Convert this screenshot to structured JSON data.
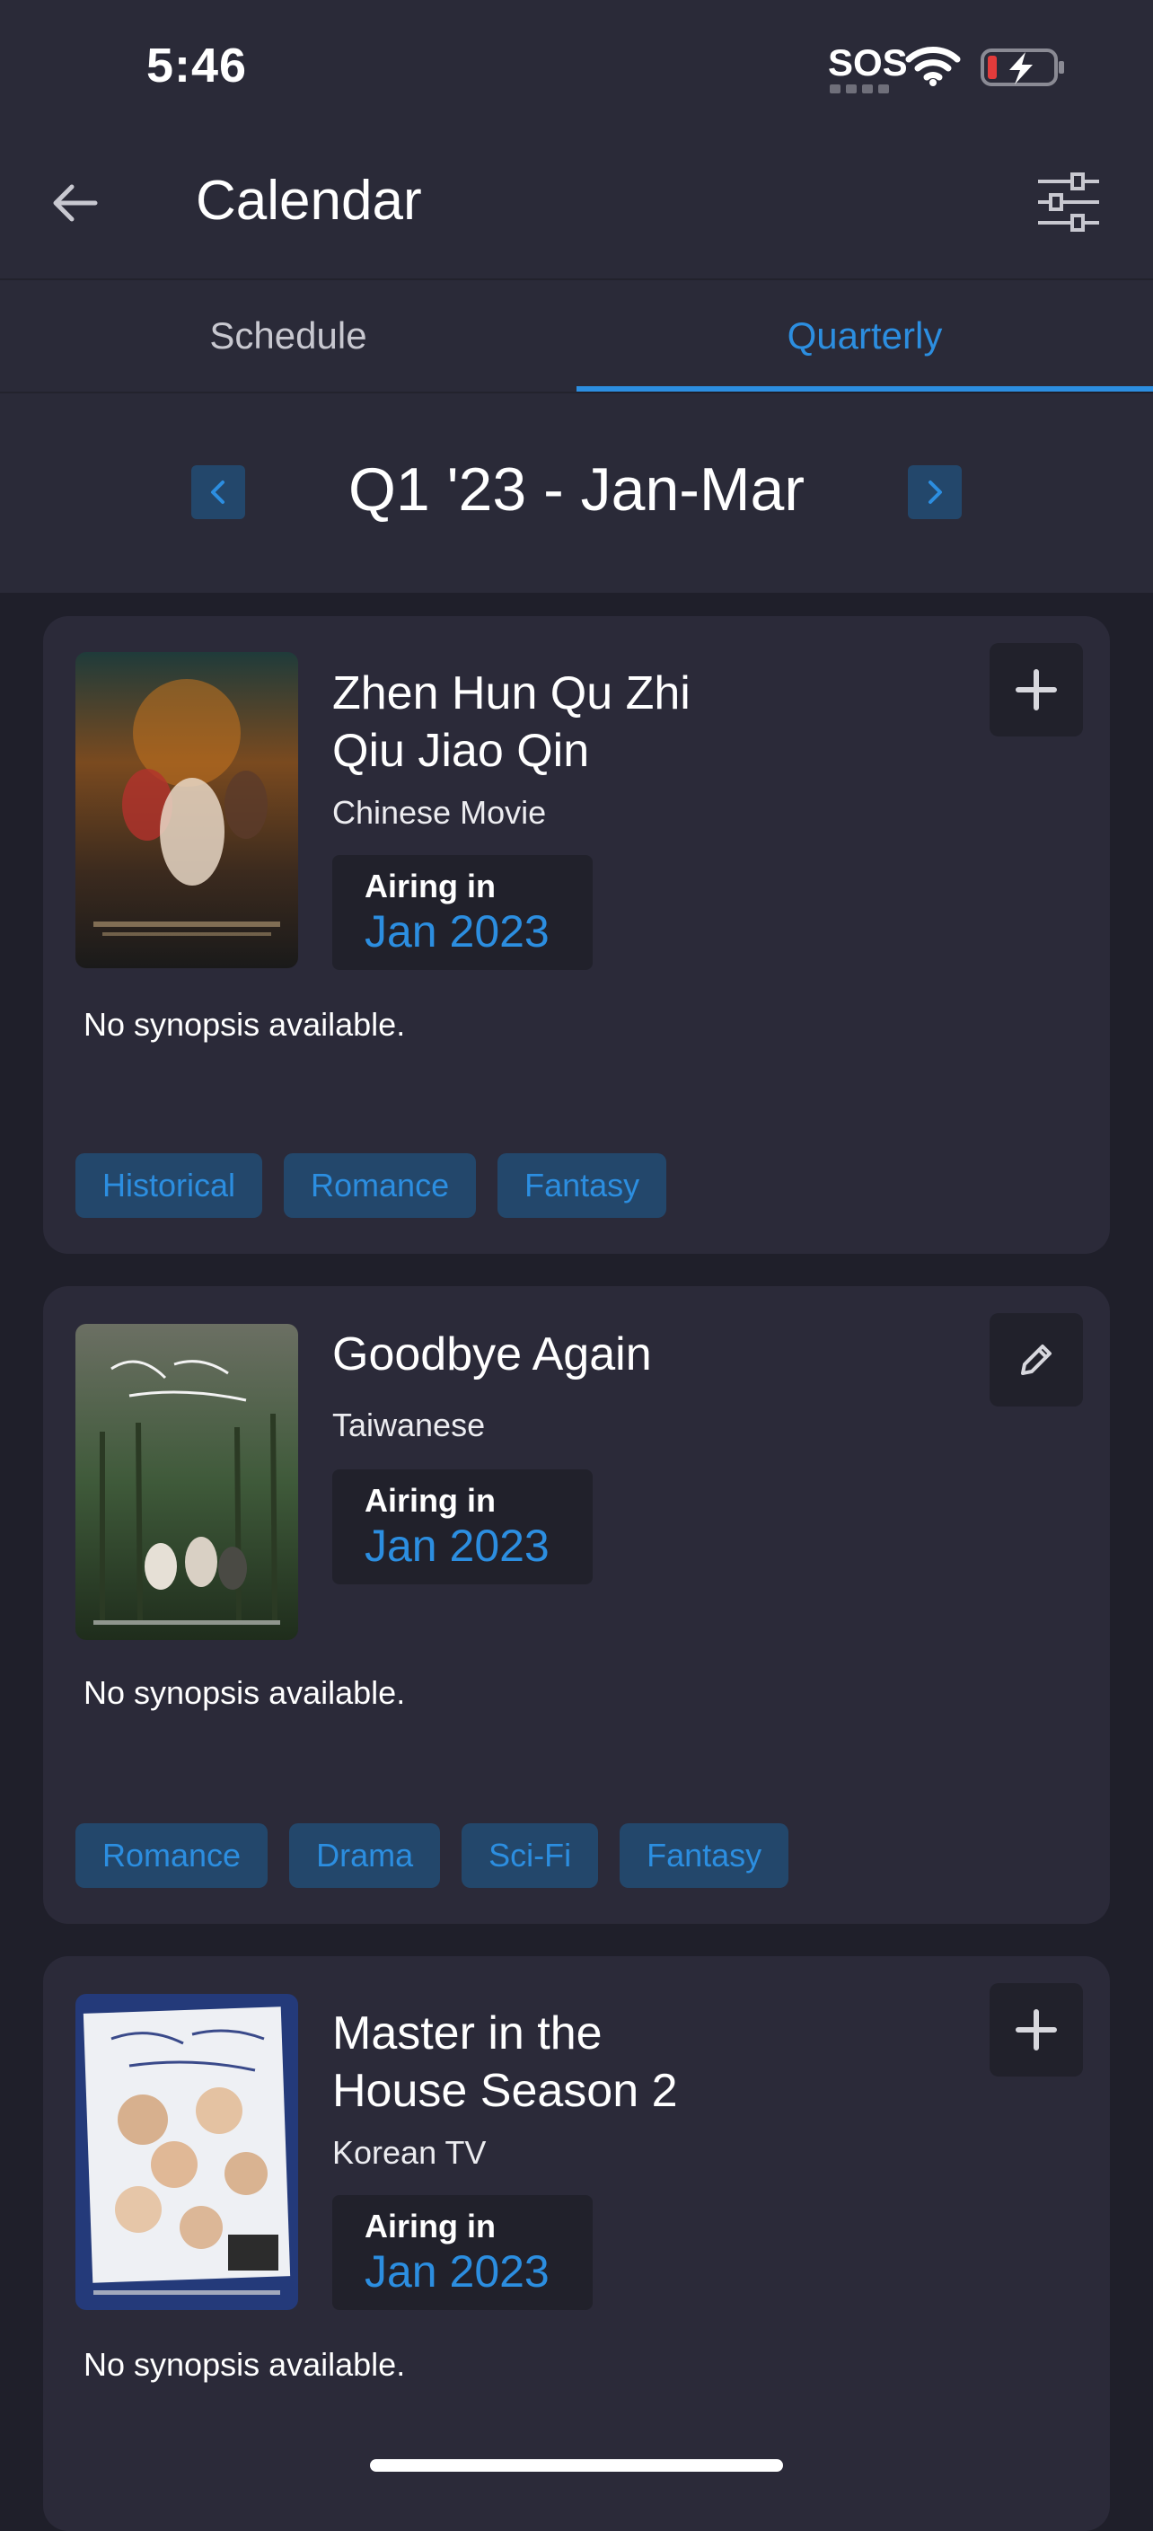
{
  "status_bar": {
    "time": "5:46",
    "sos": "SOS",
    "wifi_icon": "wifi-icon",
    "battery_icon": "battery-charging-icon"
  },
  "app_bar": {
    "title": "Calendar",
    "back_icon": "arrow-left-icon",
    "filter_icon": "sliders-icon"
  },
  "tabs": [
    {
      "label": "Schedule",
      "active": false
    },
    {
      "label": "Quarterly",
      "active": true
    }
  ],
  "quarter": {
    "label": "Q1 '23 - Jan-Mar",
    "prev_icon": "chevron-left-icon",
    "next_icon": "chevron-right-icon"
  },
  "colors": {
    "background": "#1f1f2a",
    "surface": "#2a2a38",
    "card": "#2b2a39",
    "accent": "#2c8ee0",
    "chip": "#23476b"
  },
  "cards": [
    {
      "title_line1": "Zhen Hun Qu Zhi",
      "title_line2": "Qiu Jiao Qin",
      "type": "Chinese Movie",
      "airing_label": "Airing in",
      "airing_date": "Jan 2023",
      "action_icon": "plus-icon",
      "synopsis": "No synopsis available.",
      "tags": [
        "Historical",
        "Romance",
        "Fantasy"
      ]
    },
    {
      "title_line1": "Goodbye Again",
      "type": "Taiwanese",
      "airing_label": "Airing in",
      "airing_date": "Jan 2023",
      "action_icon": "pencil-icon",
      "synopsis": "No synopsis available.",
      "tags": [
        "Romance",
        "Drama",
        "Sci-Fi",
        "Fantasy"
      ]
    },
    {
      "title_line1": "Master in the",
      "title_line2": "House Season 2",
      "type": "Korean TV",
      "airing_label": "Airing in",
      "airing_date": "Jan 2023",
      "action_icon": "plus-icon",
      "synopsis": "No synopsis available."
    }
  ]
}
